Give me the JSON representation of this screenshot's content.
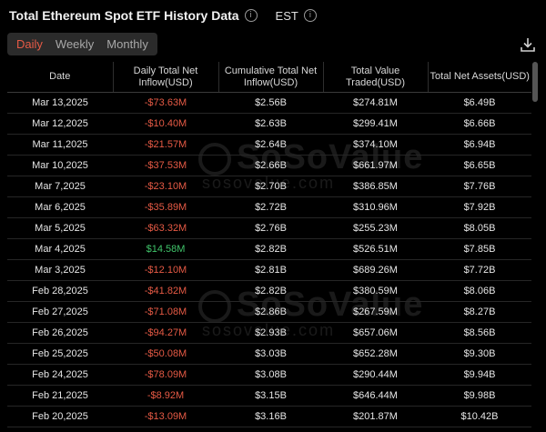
{
  "header": {
    "title": "Total Ethereum Spot ETF History Data",
    "timezone": "EST"
  },
  "tabs": [
    {
      "label": "Daily",
      "active": true
    },
    {
      "label": "Weekly",
      "active": false
    },
    {
      "label": "Monthly",
      "active": false
    }
  ],
  "watermark": {
    "brand": "SoSoValue",
    "domain": "sosovalue.com"
  },
  "table": {
    "columns": [
      "Date",
      "Daily Total Net Inflow(USD)",
      "Cumulative Total Net Inflow(USD)",
      "Total Value Traded(USD)",
      "Total Net Assets(USD)"
    ],
    "rows": [
      [
        "Mar 13,2025",
        "-$73.63M",
        "$2.56B",
        "$274.81M",
        "$6.49B"
      ],
      [
        "Mar 12,2025",
        "-$10.40M",
        "$2.63B",
        "$299.41M",
        "$6.66B"
      ],
      [
        "Mar 11,2025",
        "-$21.57M",
        "$2.64B",
        "$374.10M",
        "$6.94B"
      ],
      [
        "Mar 10,2025",
        "-$37.53M",
        "$2.66B",
        "$661.97M",
        "$6.65B"
      ],
      [
        "Mar 7,2025",
        "-$23.10M",
        "$2.70B",
        "$386.85M",
        "$7.76B"
      ],
      [
        "Mar 6,2025",
        "-$35.89M",
        "$2.72B",
        "$310.96M",
        "$7.92B"
      ],
      [
        "Mar 5,2025",
        "-$63.32M",
        "$2.76B",
        "$255.23M",
        "$8.05B"
      ],
      [
        "Mar 4,2025",
        "$14.58M",
        "$2.82B",
        "$526.51M",
        "$7.85B"
      ],
      [
        "Mar 3,2025",
        "-$12.10M",
        "$2.81B",
        "$689.26M",
        "$7.72B"
      ],
      [
        "Feb 28,2025",
        "-$41.82M",
        "$2.82B",
        "$380.59M",
        "$8.06B"
      ],
      [
        "Feb 27,2025",
        "-$71.08M",
        "$2.86B",
        "$267.59M",
        "$8.27B"
      ],
      [
        "Feb 26,2025",
        "-$94.27M",
        "$2.93B",
        "$657.06M",
        "$8.56B"
      ],
      [
        "Feb 25,2025",
        "-$50.08M",
        "$3.03B",
        "$652.28M",
        "$9.30B"
      ],
      [
        "Feb 24,2025",
        "-$78.09M",
        "$3.08B",
        "$290.44M",
        "$9.94B"
      ],
      [
        "Feb 21,2025",
        "-$8.92M",
        "$3.15B",
        "$646.44M",
        "$9.98B"
      ],
      [
        "Feb 20,2025",
        "-$13.09M",
        "$3.16B",
        "$201.87M",
        "$10.42B"
      ]
    ]
  },
  "colors": {
    "background": "#000000",
    "negative": "#e65a45",
    "positive": "#40c46a",
    "tab_active": "#e65a45"
  },
  "icons": {
    "info": "info-icon",
    "download": "download-icon"
  }
}
